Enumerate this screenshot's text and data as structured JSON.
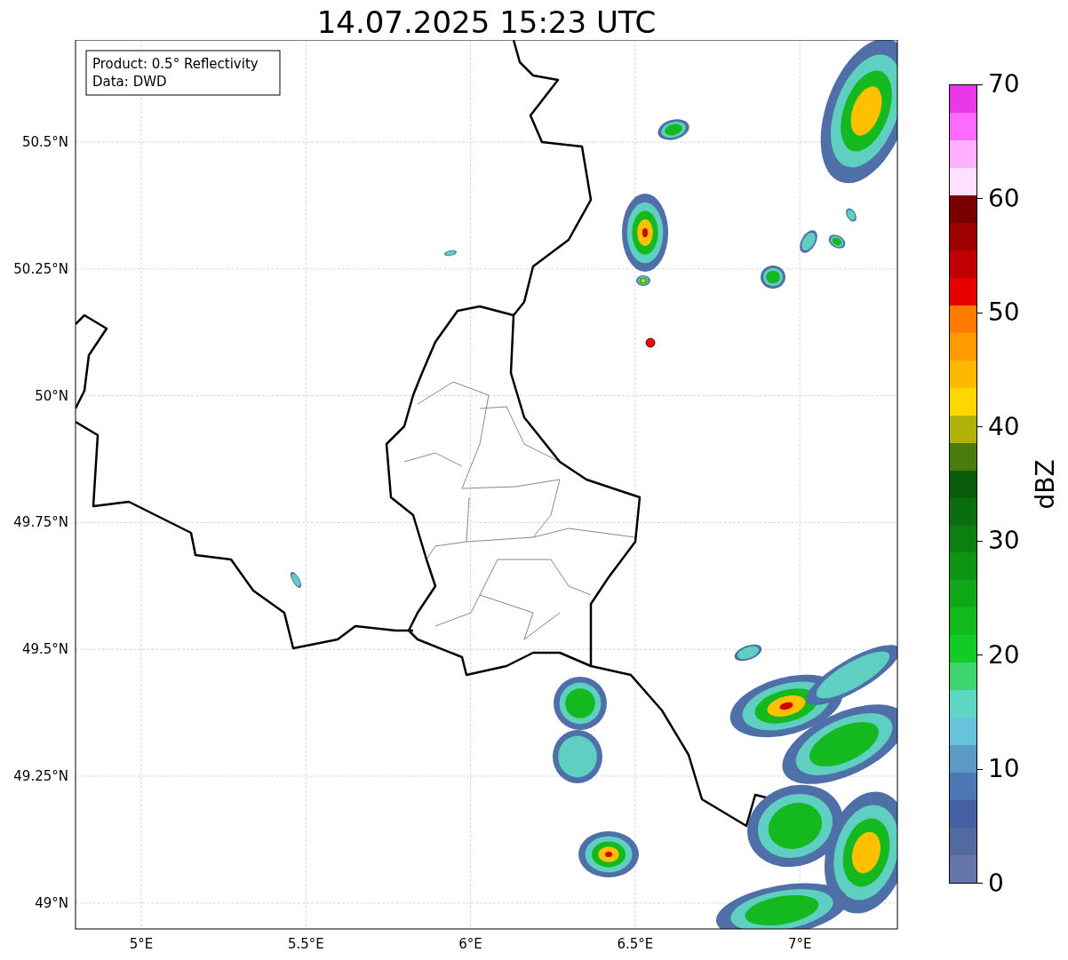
{
  "title": "14.07.2025 15:23 UTC",
  "legend": [
    "Product: 0.5° Reflectivity",
    "Data: DWD"
  ],
  "map": {
    "x_ticks": [
      "5°E",
      "5.5°E",
      "6°E",
      "6.5°E",
      "7°E"
    ],
    "y_ticks": [
      "50.5°N",
      "50.25°N",
      "50°N",
      "49.75°N",
      "49.5°N",
      "49.25°N",
      "49°N"
    ]
  },
  "colorbar": {
    "label": "dBZ",
    "ticks": [
      "70",
      "60",
      "50",
      "40",
      "30",
      "20",
      "10",
      "0"
    ],
    "segments": [
      {
        "color": "#e838e8"
      },
      {
        "color": "#ff6bff"
      },
      {
        "color": "#ffb0ff"
      },
      {
        "color": "#ffe0ff"
      },
      {
        "color": "#780000"
      },
      {
        "color": "#9e0000"
      },
      {
        "color": "#c00000"
      },
      {
        "color": "#e60000"
      },
      {
        "color": "#ff7b00"
      },
      {
        "color": "#ff9a00"
      },
      {
        "color": "#ffb800"
      },
      {
        "color": "#ffd700"
      },
      {
        "color": "#b0b20a"
      },
      {
        "color": "#487a0c"
      },
      {
        "color": "#0a5c0b"
      },
      {
        "color": "#0a6e0e"
      },
      {
        "color": "#0c8010"
      },
      {
        "color": "#0e9414"
      },
      {
        "color": "#10a818"
      },
      {
        "color": "#12ba1e"
      },
      {
        "color": "#14ca24"
      },
      {
        "color": "#3ed570"
      },
      {
        "color": "#5dd6c2"
      },
      {
        "color": "#67c2dc"
      },
      {
        "color": "#5a9ac4"
      },
      {
        "color": "#4b78b2"
      },
      {
        "color": "#4560a3"
      },
      {
        "color": "#516aa0"
      },
      {
        "color": "#6676a9"
      }
    ]
  }
}
